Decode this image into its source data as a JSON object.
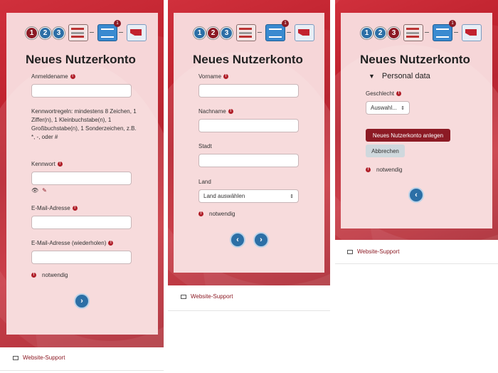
{
  "steps": [
    "1",
    "2",
    "3"
  ],
  "badge_count": "1",
  "colors": {
    "primary": "#8c1a24",
    "blue": "#2c6fa6",
    "card": "#f6d6d8",
    "bg_red": "#c42632"
  },
  "icons": {
    "form": "form-icon",
    "mail": "mail-icon",
    "envelope": "envelope-icon",
    "next": "chevron-right-icon",
    "prev": "chevron-left-icon",
    "eye": "eye-icon",
    "pencil": "pencil-icon",
    "footer": "envelope-icon"
  },
  "title": "Neues Nutzerkonto",
  "step1": {
    "username_label": "Anmeldename",
    "password_rules": "Kennwortregeln: mindestens 8 Zeichen, 1 Ziffer(n), 1 Kleinbuchstabe(n), 1 Großbuchstabe(n), 1 Sonderzeichen, z.B. *, -, oder #",
    "password_label": "Kennwort",
    "email_label": "E-Mail-Adresse",
    "email2_label": "E-Mail-Adresse (wiederholen)",
    "required_note": "notwendig"
  },
  "step2": {
    "firstname_label": "Vorname",
    "lastname_label": "Nachname",
    "city_label": "Stadt",
    "country_label": "Land",
    "country_placeholder": "Land auswählen",
    "required_note": "notwendig"
  },
  "step3": {
    "section_label": "Personal data",
    "gender_label": "Geschlecht",
    "gender_placeholder": "Auswahl...",
    "create_button": "Neues Nutzerkonto anlegen",
    "cancel_button": "Abbrechen",
    "required_note": "notwendig"
  },
  "footer": {
    "support_link": "Website-Support"
  }
}
